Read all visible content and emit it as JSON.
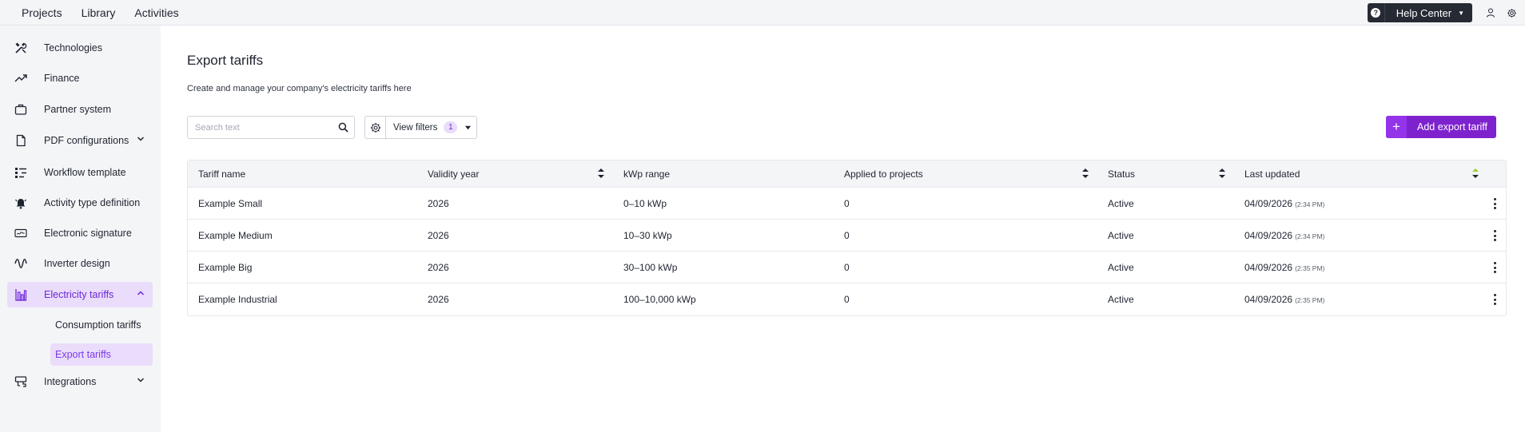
{
  "topnav": [
    "Projects",
    "Library",
    "Activities"
  ],
  "help": {
    "label": "Help Center",
    "icon": "question-icon"
  },
  "colors": {
    "accent": "#7e22ce",
    "active_bg": "#eadcfb",
    "active_text": "#6d28d9",
    "sidebar_bg": "#f4f5f7",
    "dark": "#252a33"
  },
  "sidebar": {
    "items": [
      {
        "label": "Technologies",
        "icon": "tools-icon"
      },
      {
        "label": "Finance",
        "icon": "trend-icon"
      },
      {
        "label": "Partner system",
        "icon": "briefcase-icon"
      },
      {
        "label": "PDF configurations",
        "icon": "document-icon"
      },
      {
        "label": "Workflow template",
        "icon": "workflow-icon"
      },
      {
        "label": "Activity type definition",
        "icon": "bell-icon"
      },
      {
        "label": "Electronic signature",
        "icon": "signature-icon"
      },
      {
        "label": "Inverter design",
        "icon": "wave-icon"
      },
      {
        "label": "Electricity tariffs",
        "icon": "tariff-icon"
      },
      {
        "label": "Integrations",
        "icon": "integrations-icon"
      }
    ],
    "subitems": [
      "Consumption tariffs",
      "Export tariffs"
    ]
  },
  "main": {
    "title": "Export tariffs",
    "subtitle": "Create and manage your company's electricity tariffs here",
    "search_placeholder": "Search text",
    "filters_label": "View filters",
    "filters_count": "1",
    "add_button": "Add export tariff"
  },
  "table": {
    "columns": [
      "Tariff name",
      "Validity year",
      "kWp range",
      "Applied to projects",
      "Status",
      "Last updated"
    ],
    "rows": [
      {
        "name": "Example Small",
        "year": "2026",
        "range": "0–10 kWp",
        "applied": "0",
        "status": "Active",
        "date": "04/09/2026",
        "time": "(2:34 PM)"
      },
      {
        "name": "Example Medium",
        "year": "2026",
        "range": "10–30 kWp",
        "applied": "0",
        "status": "Active",
        "date": "04/09/2026",
        "time": "(2:34 PM)"
      },
      {
        "name": "Example Big",
        "year": "2026",
        "range": "30–100 kWp",
        "applied": "0",
        "status": "Active",
        "date": "04/09/2026",
        "time": "(2:35 PM)"
      },
      {
        "name": "Example Industrial",
        "year": "2026",
        "range": "100–10,000 kWp",
        "applied": "0",
        "status": "Active",
        "date": "04/09/2026",
        "time": "(2:35 PM)"
      }
    ]
  }
}
